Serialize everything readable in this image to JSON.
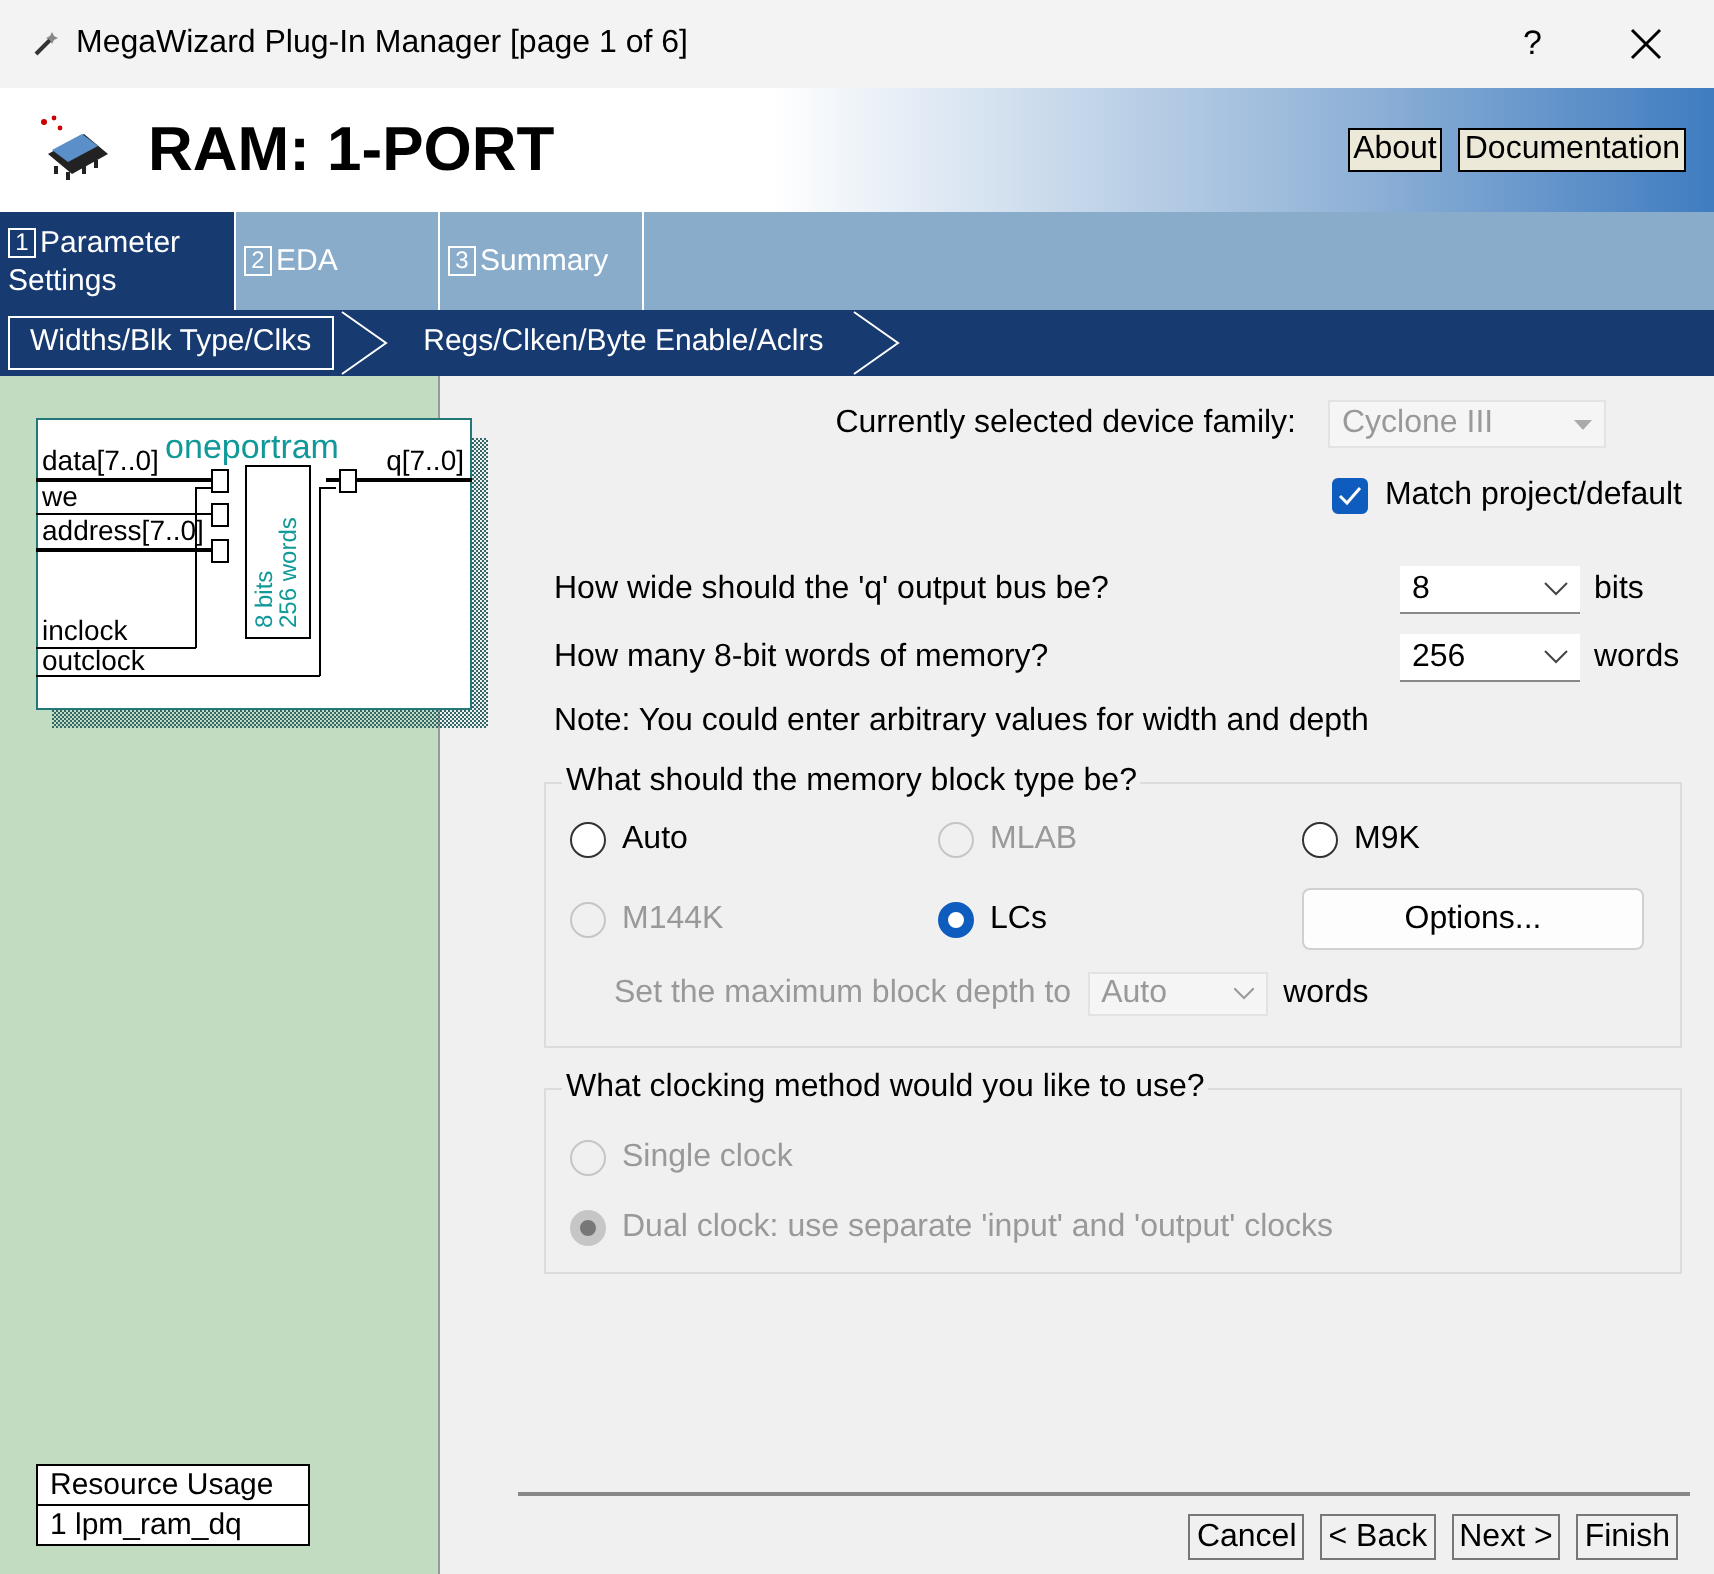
{
  "window": {
    "title": "MegaWizard Plug-In Manager [page 1 of 6]",
    "help": "?"
  },
  "header": {
    "title": "RAM: 1-PORT",
    "buttons": [
      "About",
      "Documentation"
    ]
  },
  "tabs": [
    {
      "number": "1",
      "label": "Parameter Settings",
      "selected": true
    },
    {
      "number": "2",
      "label": "EDA",
      "selected": false
    },
    {
      "number": "3",
      "label": "Summary",
      "selected": false
    }
  ],
  "steps": [
    {
      "label": "Widths/Blk Type/Clks",
      "selected": true
    },
    {
      "label": "Regs/Clken/Byte Enable/Aclrs",
      "selected": false
    }
  ],
  "diagram": {
    "name": "oneportram",
    "inputs": [
      "data[7..0]",
      "we",
      "address[7..0]",
      "inclock",
      "outclock"
    ],
    "output": "q[7..0]",
    "memory_labels": [
      "8 bits",
      "256 words"
    ]
  },
  "resource_usage": {
    "title": "Resource Usage",
    "value": "1 lpm_ram_dq"
  },
  "device_family": {
    "label": "Currently selected device family:",
    "value": "Cyclone III",
    "disabled": true
  },
  "match_project": {
    "label": "Match project/default",
    "checked": true
  },
  "width": {
    "label": "How wide should the 'q' output bus be?",
    "value": "8",
    "unit": "bits"
  },
  "depth": {
    "label": "How many 8-bit words of memory?",
    "value": "256",
    "unit": "words"
  },
  "note": "Note: You could enter arbitrary values for width and depth",
  "memory_block": {
    "legend": "What should the memory block type be?",
    "options": [
      {
        "label": "Auto",
        "selected": false,
        "disabled": false
      },
      {
        "label": "MLAB",
        "selected": false,
        "disabled": true
      },
      {
        "label": "M9K",
        "selected": false,
        "disabled": false
      },
      {
        "label": "M144K",
        "selected": false,
        "disabled": true
      },
      {
        "label": "LCs",
        "selected": true,
        "disabled": false
      }
    ],
    "options_button": "Options...",
    "max_depth": {
      "label": "Set the maximum block depth to",
      "value": "Auto",
      "unit": "words",
      "disabled": true
    }
  },
  "clocking": {
    "legend": "What clocking method would you like to use?",
    "options": [
      {
        "label": "Single clock",
        "selected": false,
        "disabled": true
      },
      {
        "label": "Dual clock: use separate 'input' and 'output' clocks",
        "selected": true,
        "disabled": true
      }
    ]
  },
  "buttons": [
    "Cancel",
    "< Back",
    "Next >",
    "Finish"
  ]
}
